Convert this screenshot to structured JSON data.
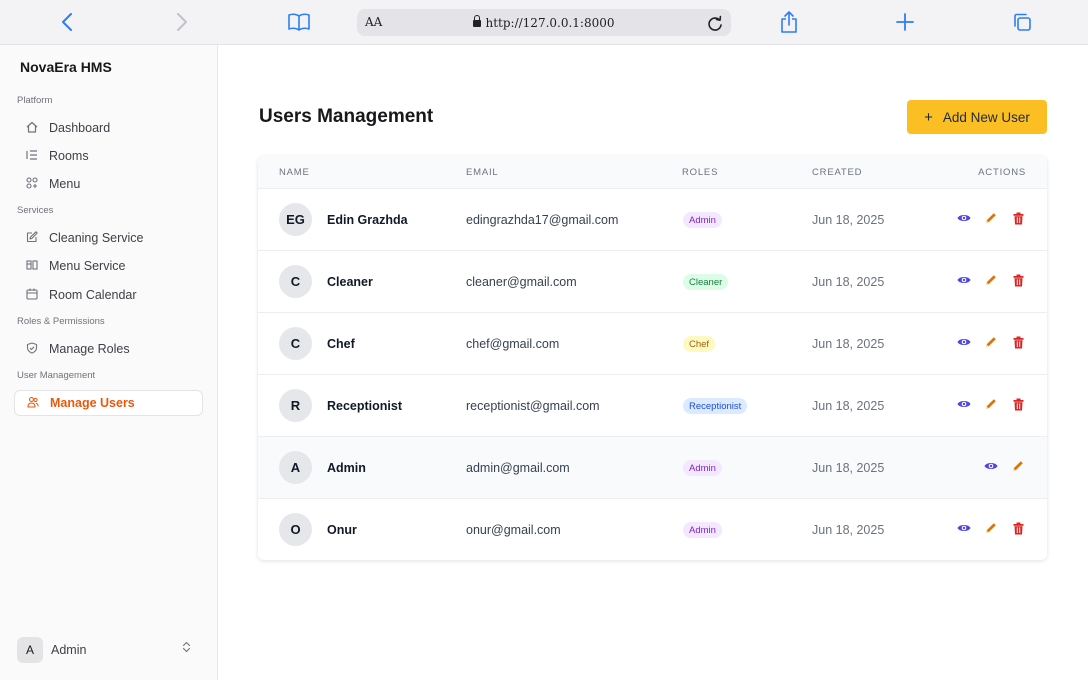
{
  "browser": {
    "aa_label": "AA",
    "url": "http://127.0.0.1:8000",
    "colors": {
      "accent": "#2f7cf6"
    }
  },
  "sidebar": {
    "brand": "NovaEra HMS",
    "sections": [
      {
        "label": "Platform",
        "items": [
          {
            "label": "Dashboard",
            "icon": "home-icon"
          },
          {
            "label": "Rooms",
            "icon": "list-icon"
          },
          {
            "label": "Menu",
            "icon": "grid-icon"
          }
        ]
      },
      {
        "label": "Services",
        "items": [
          {
            "label": "Cleaning Service",
            "icon": "edit-icon"
          },
          {
            "label": "Menu Service",
            "icon": "columns-icon"
          },
          {
            "label": "Room Calendar",
            "icon": "calendar-icon"
          }
        ]
      },
      {
        "label": "Roles & Permissions",
        "items": [
          {
            "label": "Manage Roles",
            "icon": "shield-icon"
          }
        ]
      },
      {
        "label": "User Management",
        "items": [
          {
            "label": "Manage Users",
            "icon": "users-icon",
            "active": true
          }
        ]
      }
    ],
    "user": {
      "initial": "A",
      "name": "Admin"
    },
    "colors": {
      "active": "#ea580c"
    }
  },
  "main": {
    "title": "Users Management",
    "add_button": "Add New User",
    "columns": [
      "NAME",
      "EMAIL",
      "ROLES",
      "CREATED",
      "ACTIONS"
    ],
    "rows": [
      {
        "initials": "EG",
        "name": "Edin Grazhda",
        "email": "edingrazhda17@gmail.com",
        "role": "Admin",
        "created": "Jun 18, 2025",
        "deletable": true
      },
      {
        "initials": "C",
        "name": "Cleaner",
        "email": "cleaner@gmail.com",
        "role": "Cleaner",
        "created": "Jun 18, 2025",
        "deletable": true
      },
      {
        "initials": "C",
        "name": "Chef",
        "email": "chef@gmail.com",
        "role": "Chef",
        "created": "Jun 18, 2025",
        "deletable": true
      },
      {
        "initials": "R",
        "name": "Receptionist",
        "email": "receptionist@gmail.com",
        "role": "Receptionist",
        "created": "Jun 18, 2025",
        "deletable": true
      },
      {
        "initials": "A",
        "name": "Admin",
        "email": "admin@gmail.com",
        "role": "Admin",
        "created": "Jun 18, 2025",
        "deletable": false
      },
      {
        "initials": "O",
        "name": "Onur",
        "email": "onur@gmail.com",
        "role": "Admin",
        "created": "Jun 18, 2025",
        "deletable": true
      }
    ],
    "role_colors": {
      "Admin": {
        "bg": "#f3e8ff",
        "fg": "#7e22ce"
      },
      "Cleaner": {
        "bg": "#dcfce7",
        "fg": "#15803d"
      },
      "Chef": {
        "bg": "#fef9c3",
        "fg": "#a16207"
      },
      "Receptionist": {
        "bg": "#dbeafe",
        "fg": "#1d4ed8"
      }
    },
    "colors": {
      "add_button": "#fbbf24",
      "view": "#4f46e5",
      "edit": "#d97706",
      "delete": "#dc2626"
    }
  }
}
